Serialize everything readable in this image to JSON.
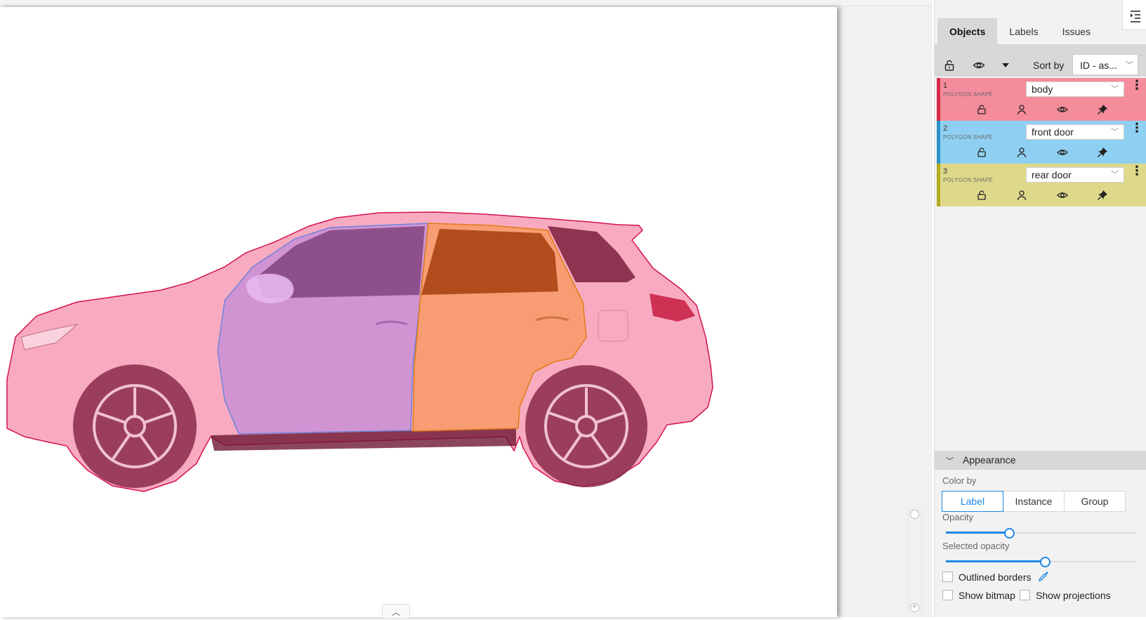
{
  "tabs": [
    {
      "label": "Objects",
      "active": true
    },
    {
      "label": "Labels",
      "active": false
    },
    {
      "label": "Issues",
      "active": false
    }
  ],
  "toolbar": {
    "lock_icon": "lock-icon",
    "eye_icon": "eye-icon",
    "filter_icon": "caret-down-icon",
    "sort_label": "Sort by",
    "sort_value": "ID - as..."
  },
  "objects": [
    {
      "id": "1",
      "type": "POLYGON SHAPE",
      "label": "body",
      "color": "#f48c9b",
      "stripe": "#d62a47"
    },
    {
      "id": "2",
      "type": "POLYGON SHAPE",
      "label": "front door",
      "color": "#8fd0f2",
      "stripe": "#2b92c9"
    },
    {
      "id": "3",
      "type": "POLYGON SHAPE",
      "label": "rear door",
      "color": "#ded98a",
      "stripe": "#b3ab1c"
    }
  ],
  "appearance": {
    "title": "Appearance",
    "color_by_label": "Color by",
    "color_by_options": [
      "Label",
      "Instance",
      "Group"
    ],
    "color_by_selected": "Label",
    "opacity_label": "Opacity",
    "opacity_value": 0.33,
    "selected_opacity_label": "Selected opacity",
    "selected_opacity_value": 0.52,
    "outlined_borders_label": "Outlined borders",
    "outlined_borders_checked": false,
    "show_bitmap_label": "Show bitmap",
    "show_bitmap_checked": false,
    "show_projections_label": "Show projections",
    "show_projections_checked": false
  },
  "colors": {
    "accent": "#1e88e5",
    "body_mask": "#f58aa8",
    "front_door_mask": "#c98fd6",
    "rear_door_mask": "#f79a6a"
  }
}
